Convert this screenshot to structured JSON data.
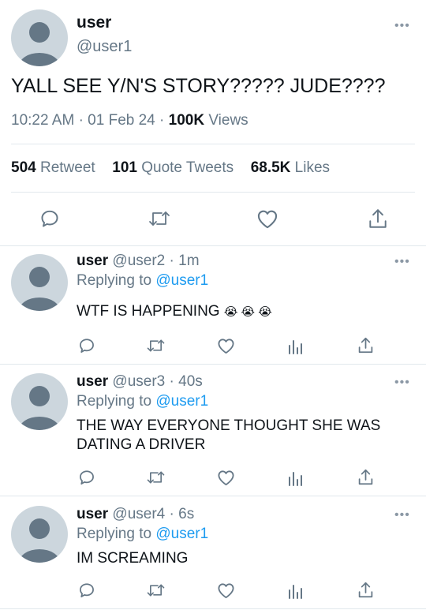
{
  "main_tweet": {
    "display_name": "user",
    "handle": "@user1",
    "text": "YALL SEE Y/N'S STORY????? JUDE????",
    "time": "10:22 AM",
    "date": "01 Feb 24",
    "views_count": "100K",
    "views_label": "Views",
    "retweets_count": "504",
    "retweets_label": "Retweet",
    "quotes_count": "101",
    "quotes_label": "Quote Tweets",
    "likes_count": "68.5K",
    "likes_label": "Likes"
  },
  "replies": [
    {
      "display_name": "user",
      "handle": "@user2",
      "time": "1m",
      "replying_label": "Replying to",
      "replying_to": "@user1",
      "text_lines": [
        "WTF IS HAPPENING"
      ],
      "emoji": "😭 😭 😭"
    },
    {
      "display_name": "user",
      "handle": "@user3",
      "time": "40s",
      "replying_label": "Replying to",
      "replying_to": "@user1",
      "text_lines": [
        "THE WAY EVERYONE THOUGHT SHE WAS",
        "DATING A DRIVER"
      ]
    },
    {
      "display_name": "user",
      "handle": "@user4",
      "time": "6s",
      "replying_label": "Replying to",
      "replying_to": "@user1",
      "text_lines": [
        "IM SCREAMING"
      ]
    }
  ],
  "separator": "·",
  "more_glyph": "•••",
  "icons": [
    "avatar-icon",
    "more-icon",
    "reply-icon",
    "retweet-icon",
    "like-icon",
    "share-icon",
    "analytics-icon"
  ],
  "colors": {
    "link": "#1d9bf0",
    "secondary_text": "#657786",
    "divider": "#e1e8ed",
    "avatar": "#ccd6dd",
    "icon": "#657786"
  }
}
